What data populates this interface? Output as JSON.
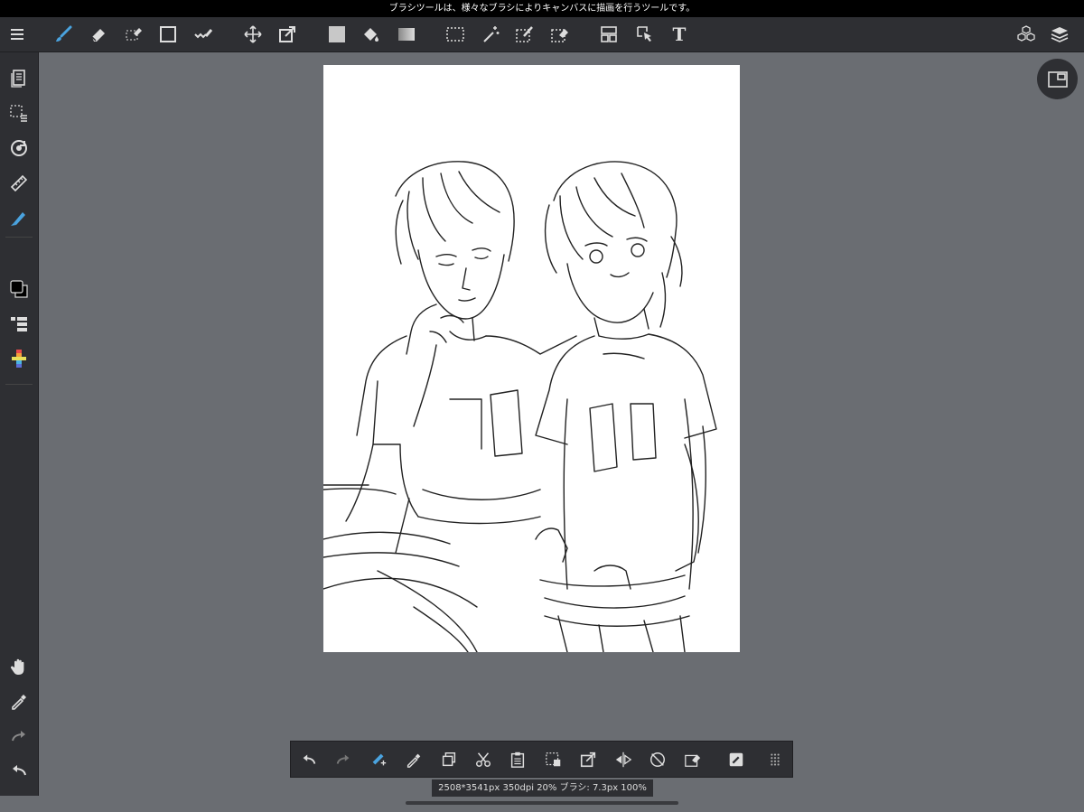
{
  "status_bar": {
    "hint": "ブラシツールは、様々なブラシによりキャンバスに描画を行うツールです。"
  },
  "info_bar": {
    "text": "2508*3541px 350dpi 20% ブラシ: 7.3px 100%"
  },
  "icons": {
    "menu": "menu-icon",
    "brush": "brush-icon",
    "eraser": "eraser-icon",
    "selection_eraser": "selection-eraser-icon",
    "rectangle": "rectangle-icon",
    "correction": "correction-pen-icon",
    "move": "move-icon",
    "transform": "transform-icon",
    "fill_color": "fill-color-icon",
    "bucket": "bucket-icon",
    "gradient": "gradient-icon",
    "marquee": "marquee-selection-icon",
    "magic_wand": "magic-wand-icon",
    "select_pen": "select-pen-icon",
    "select_eraser": "select-eraser-icon",
    "frame": "frame-divider-icon",
    "object": "object-selection-icon",
    "text": "text-tool-icon",
    "material": "material-icon",
    "layers": "layers-icon"
  },
  "text_tool_glyph": "T",
  "colors": {
    "accent": "#4aa3df",
    "toolbar_bg": "#2e2f33",
    "workspace_bg": "#6a6d72",
    "foreground_color": "#000000",
    "background_color": "#ffffff"
  }
}
